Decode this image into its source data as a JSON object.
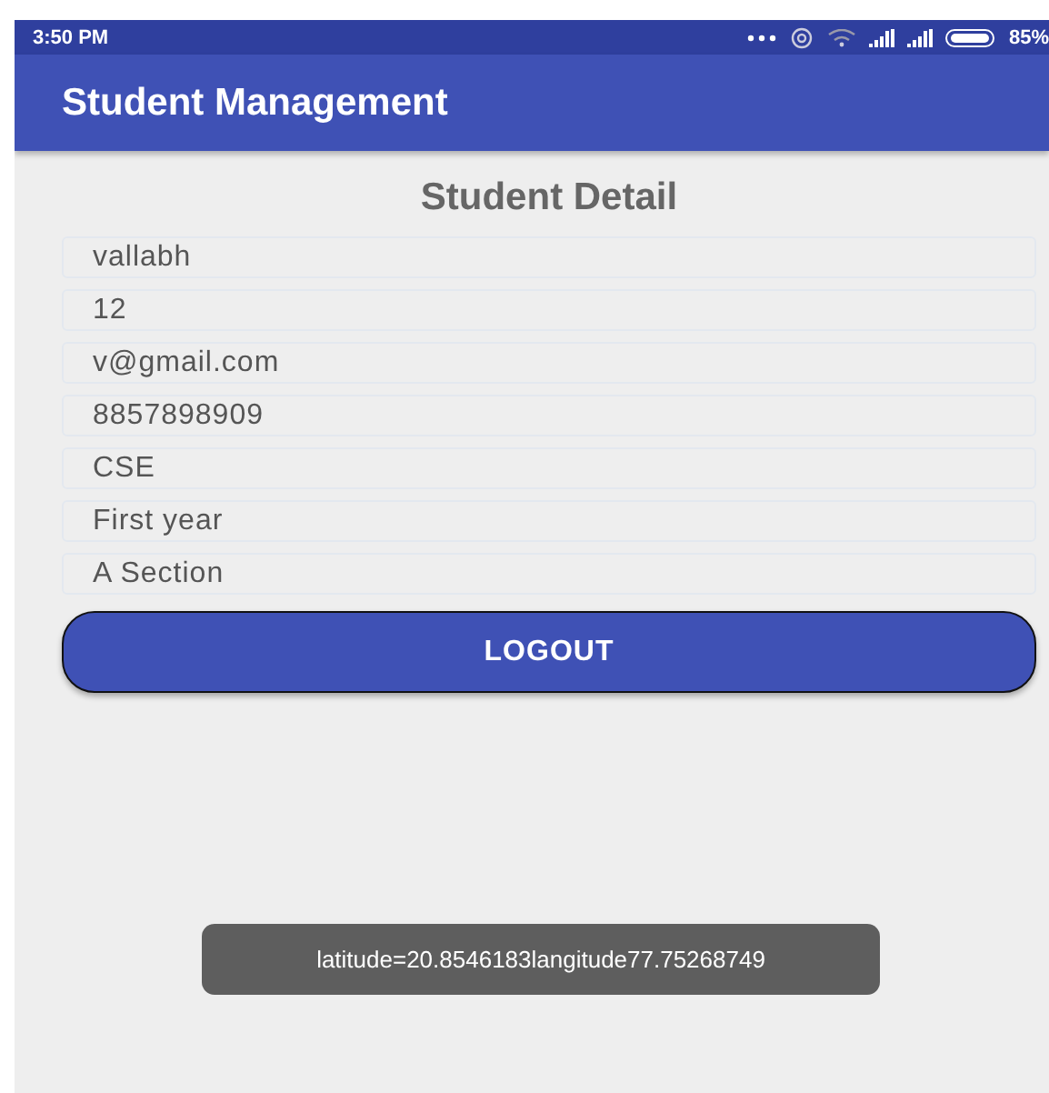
{
  "status_bar": {
    "time": "3:50 PM",
    "battery": "85%"
  },
  "app_bar": {
    "title": "Student Management"
  },
  "heading": "Student Detail",
  "fields": [
    {
      "value": "vallabh"
    },
    {
      "value": "12"
    },
    {
      "value": "v@gmail.com"
    },
    {
      "value": "8857898909"
    },
    {
      "value": "CSE"
    },
    {
      "value": "First year"
    },
    {
      "value": "A Section"
    }
  ],
  "button": "LOGOUT",
  "toast": "latitude=20.8546183langitude77.75268749"
}
